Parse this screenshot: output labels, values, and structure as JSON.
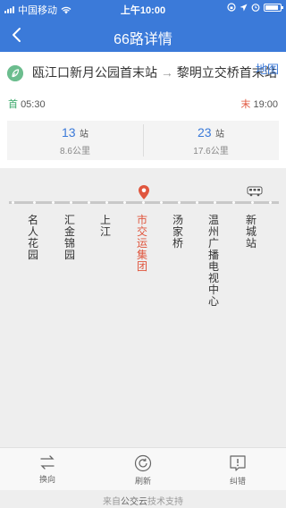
{
  "status_bar": {
    "carrier": "中国移动",
    "time": "上午10:00",
    "battery_level": 0.85
  },
  "nav": {
    "title": "66路详情"
  },
  "route": {
    "from": "瓯江口新月公园首末站",
    "to": "黎明立交桥首末站",
    "map_link": "地图",
    "first_label": "首",
    "first_time": "05:30",
    "last_label": "末",
    "last_time": "19:00"
  },
  "stats": [
    {
      "count": "13",
      "unit": "站",
      "distance": "8.6公里"
    },
    {
      "count": "23",
      "unit": "站",
      "distance": "17.6公里"
    }
  ],
  "stations": [
    {
      "name": "名人花园",
      "current": false
    },
    {
      "name": "汇金锦园",
      "current": false
    },
    {
      "name": "上江",
      "current": false
    },
    {
      "name": "市交运集团",
      "current": true
    },
    {
      "name": "汤家桥",
      "current": false
    },
    {
      "name": "温州广播电视中心",
      "current": false
    },
    {
      "name": "新城站",
      "current": false
    }
  ],
  "tabs": {
    "switch": "换向",
    "refresh": "刷新",
    "report": "纠错"
  },
  "footer": {
    "prefix": "来自",
    "brand": "公交云",
    "suffix": "技术支持"
  },
  "colors": {
    "primary": "#3b7ad9",
    "current_station": "#e0563e",
    "first_tag": "#3aa86a",
    "last_tag": "#e0563e"
  }
}
